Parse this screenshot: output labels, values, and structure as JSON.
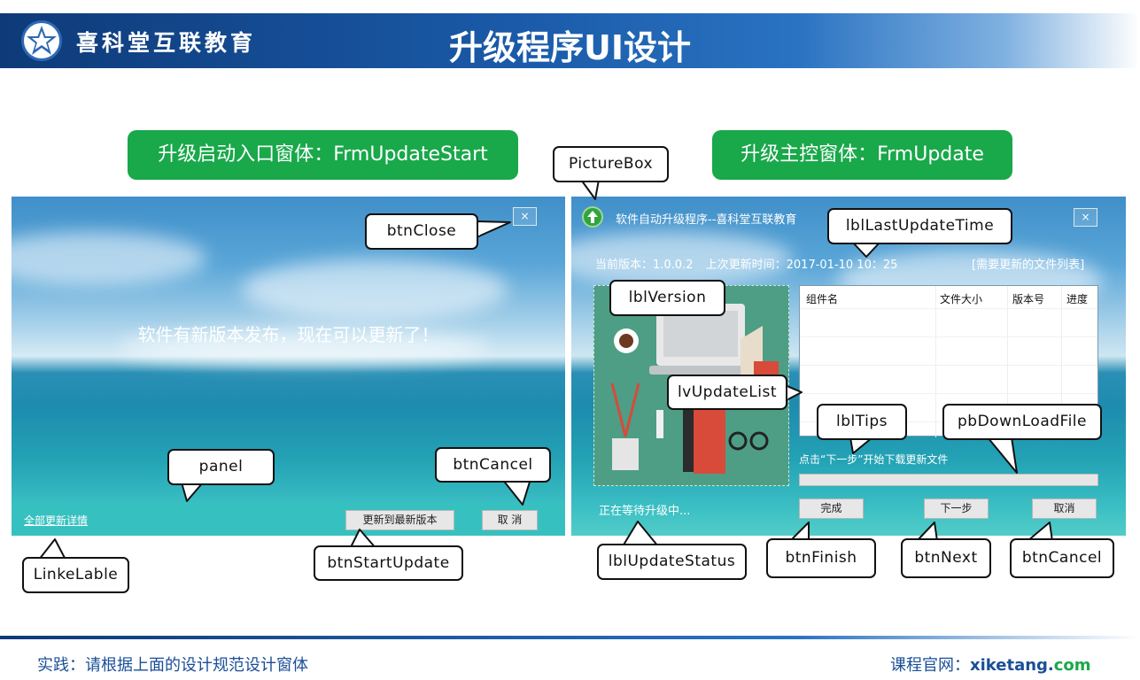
{
  "banner": {
    "brand": "喜科堂互联教育",
    "title": "升级程序UI设计"
  },
  "pills": {
    "start": "升级启动入口窗体：FrmUpdateStart",
    "update": "升级主控窗体：FrmUpdate"
  },
  "start_window": {
    "message": "软件有新版本发布，现在可以更新了！",
    "close": "×",
    "link": "全部更新详情",
    "update_button": "更新到最新版本",
    "cancel_button": "取  消"
  },
  "update_window": {
    "title": "软件自动升级程序--喜科堂互联教育",
    "close": "×",
    "version_label": "当前版本：1.0.0.2",
    "last_update": "上次更新时间：2017-01-10  10：25",
    "file_list_link": "[需要更新的文件列表]",
    "columns": [
      "组件名",
      "文件大小",
      "版本号",
      "进度"
    ],
    "tips": "点击“下一步”开始下载更新文件",
    "progress": 0,
    "status": "正在等待升级中...",
    "finish_button": "完成",
    "next_button": "下一步",
    "cancel_button": "取消"
  },
  "callouts": {
    "btnClose": "btnClose",
    "panel": "panel",
    "btnCancelLeft": "btnCancel",
    "LinkeLable": "LinkeLable",
    "btnStartUpdate": "btnStartUpdate",
    "PictureBox": "PictureBox",
    "lblLastUpdateTime": "lblLastUpdateTime",
    "lblVersion": "lblVersion",
    "lvUpdateList": "lvUpdateList",
    "lblTips": "lblTips",
    "pbDownLoadFile": "pbDownLoadFile",
    "lblUpdateStatus": "lblUpdateStatus",
    "btnFinish": "btnFinish",
    "btnNext": "btnNext",
    "btnCancelRight": "btnCancel"
  },
  "footer": {
    "left": "实践：请根据上面的设计规范设计窗体",
    "right_label": "课程官网：",
    "right_site": "xiketang.",
    "right_tld": "com"
  },
  "colors": {
    "banner": "#1a5aa8",
    "pill_green": "#19a84a",
    "panel_teal": "#36c1c0",
    "footer_text": "#1a4f97"
  }
}
